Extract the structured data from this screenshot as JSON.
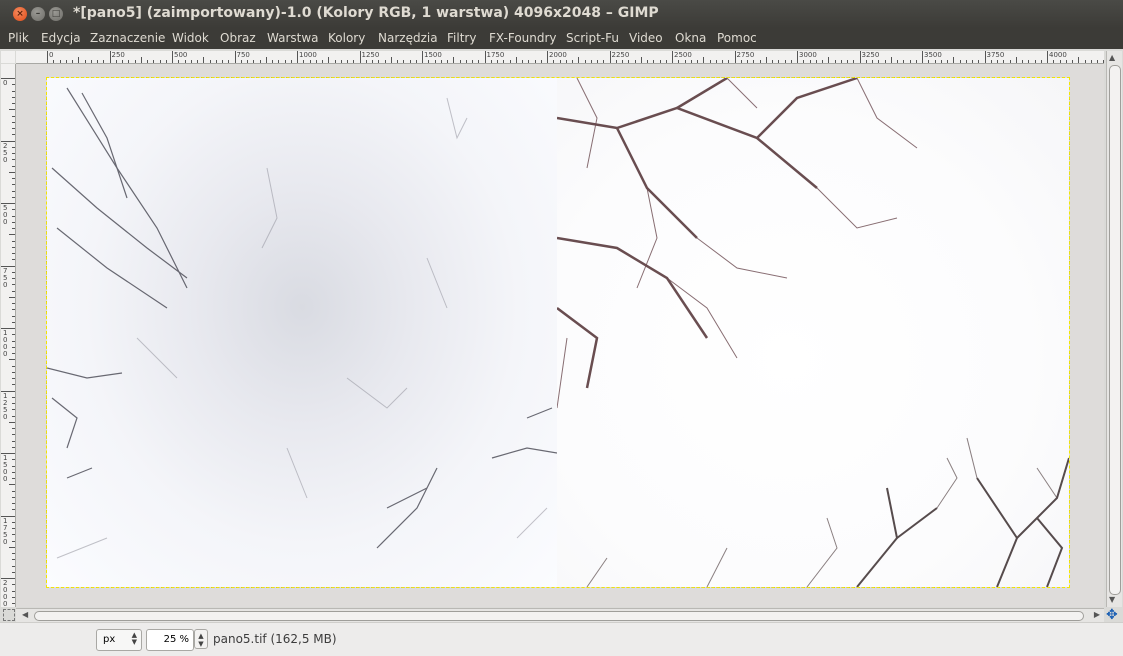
{
  "window": {
    "title": "*[pano5] (zaimportowany)-1.0 (Kolory RGB, 1 warstwa) 4096x2048 – GIMP",
    "close_glyph": "×",
    "minimize_glyph": "–",
    "maximize_glyph": "□"
  },
  "menu": {
    "items": [
      "Plik",
      "Edycja",
      "Zaznaczenie",
      "Widok",
      "Obraz",
      "Warstwa",
      "Kolory",
      "Narzędzia",
      "Filtry",
      "FX-Foundry",
      "Script-Fu",
      "Video",
      "Okna",
      "Pomoc"
    ]
  },
  "ruler_top": {
    "labels": [
      "0",
      "250",
      "500",
      "750",
      "1000",
      "1250",
      "1500",
      "1750",
      "2000",
      "2250",
      "2500",
      "2750",
      "3000",
      "3250",
      "3500",
      "3750",
      "4000"
    ]
  },
  "ruler_left": {
    "labels": [
      "0",
      "250",
      "500",
      "750",
      "1000",
      "1250",
      "1500",
      "1750",
      "2000"
    ]
  },
  "status": {
    "unit": "px",
    "zoom": "25 %",
    "file_info": "pano5.tif (162,5 MB)"
  },
  "icons": {
    "nav": "navigate-icon",
    "quick_mask": "quick-mask-icon"
  }
}
